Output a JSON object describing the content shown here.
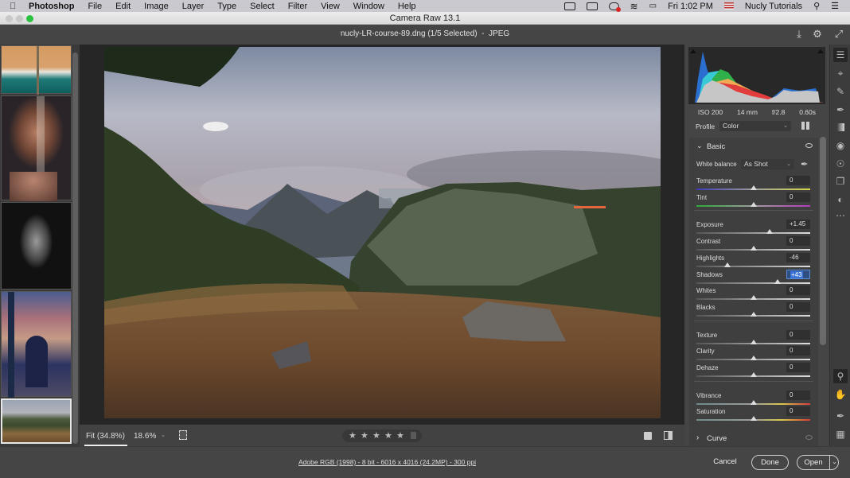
{
  "menubar": {
    "app": "Photoshop",
    "items": [
      "File",
      "Edit",
      "Image",
      "Layer",
      "Type",
      "Select",
      "Filter",
      "View",
      "Window",
      "Help"
    ],
    "clock": "Fri 1:02 PM",
    "user": "Nucly Tutorials"
  },
  "window": {
    "title": "Camera Raw 13.1"
  },
  "header": {
    "filename": "nucly-LR-course-89.dng (1/5 Selected)  -  JPEG"
  },
  "filmstrip": {
    "thumbnails": [
      {
        "name": "aerial-beach",
        "selected": false
      },
      {
        "name": "portrait-veil",
        "selected": false
      },
      {
        "name": "portrait-bw",
        "selected": false
      },
      {
        "name": "building-facade",
        "selected": false
      },
      {
        "name": "mountain-landscape",
        "selected": true
      }
    ]
  },
  "viewbar": {
    "fit_label": "Fit (34.8%)",
    "zoom_value": "18.6%",
    "rating_stars": 5,
    "rating_value": 0
  },
  "histogram": {
    "exif": {
      "iso": "ISO 200",
      "focal": "14 mm",
      "aperture": "f/2.8",
      "shutter": "0.60s"
    }
  },
  "profile": {
    "label": "Profile",
    "value": "Color"
  },
  "basic": {
    "title": "Basic",
    "white_balance": {
      "label": "White balance",
      "value": "As Shot"
    },
    "groups": [
      [
        {
          "label": "Temperature",
          "value": "0",
          "pos": 0.5,
          "track": "temp"
        },
        {
          "label": "Tint",
          "value": "0",
          "pos": 0.5,
          "track": "tint"
        }
      ],
      [
        {
          "label": "Exposure",
          "value": "+1.45",
          "pos": 0.645
        },
        {
          "label": "Contrast",
          "value": "0",
          "pos": 0.5
        },
        {
          "label": "Highlights",
          "value": "-46",
          "pos": 0.27
        },
        {
          "label": "Shadows",
          "value": "+43",
          "pos": 0.715,
          "active": true
        },
        {
          "label": "Whites",
          "value": "0",
          "pos": 0.5
        },
        {
          "label": "Blacks",
          "value": "0",
          "pos": 0.5
        }
      ],
      [
        {
          "label": "Texture",
          "value": "0",
          "pos": 0.5
        },
        {
          "label": "Clarity",
          "value": "0",
          "pos": 0.5
        },
        {
          "label": "Dehaze",
          "value": "0",
          "pos": 0.5
        }
      ],
      [
        {
          "label": "Vibrance",
          "value": "0",
          "pos": 0.5,
          "track": "sat"
        },
        {
          "label": "Saturation",
          "value": "0",
          "pos": 0.5,
          "track": "sat"
        }
      ]
    ]
  },
  "curve": {
    "title": "Curve"
  },
  "footer": {
    "info": "Adobe RGB (1998) - 8 bit - 6016 x 4016 (24.2MP) - 300 ppi",
    "cancel": "Cancel",
    "done": "Done",
    "open": "Open"
  },
  "tools": [
    "edit-icon",
    "crop-icon",
    "healing-icon",
    "brush-icon",
    "gradient-icon",
    "radial-icon",
    "red-eye-icon",
    "snapshots-icon",
    "presets-icon",
    "more-icon"
  ],
  "tools_bottom": [
    "zoom-icon",
    "hand-icon",
    "color-sampler-icon",
    "grid-icon"
  ]
}
